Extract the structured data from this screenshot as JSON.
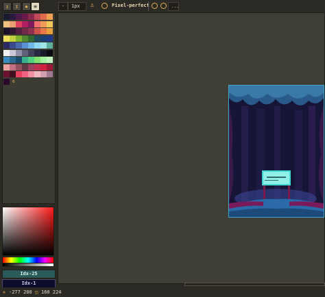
{
  "toolbar": {
    "brush_size": "1px",
    "pixel_perfect_label": "Pixel-perfect",
    "more_label": "..."
  },
  "palette": {
    "colors": [
      "#1a1a2e",
      "#2a1a3e",
      "#4a1a4a",
      "#6a1a4a",
      "#8a2a4a",
      "#c04a5a",
      "#e06a4a",
      "#f0a050",
      "#f0c080",
      "#e8a070",
      "#e04060",
      "#b02060",
      "#801a5a",
      "#f07070",
      "#f09a5a",
      "#f0c85a",
      "#1a1028",
      "#301830",
      "#502040",
      "#702a48",
      "#903050",
      "#d0504a",
      "#e87848",
      "#e8a040",
      "#f0e060",
      "#c0d040",
      "#80b030",
      "#508830",
      "#306830",
      "#20485a",
      "#184070",
      "#203888",
      "#2a2a60",
      "#3a4a90",
      "#4a6ab0",
      "#5a90d0",
      "#70b8e8",
      "#90d8f0",
      "#a0e8e8",
      "#60b0a0",
      "#f0f0f0",
      "#c8c8d8",
      "#9090a8",
      "#606078",
      "#404058",
      "#282840",
      "#181828",
      "#0a0a14",
      "#3a8ac0",
      "#2a6a90",
      "#1a4a6a",
      "#3ab090",
      "#50d080",
      "#80e070",
      "#a0f0a0",
      "#c0f0c0",
      "#e8a0a0",
      "#c07080",
      "#905060",
      "#603848",
      "#a04060",
      "#c03050",
      "#d02040",
      "#a01838",
      "#6a1030",
      "#401020",
      "#e84060",
      "#f06080",
      "#f090a0",
      "#f0b8c0",
      "#d0a0b0",
      "#a07890",
      "#2a0a2a"
    ],
    "selected_index_label": "0"
  },
  "picker": {
    "index_primary": "Idx-25",
    "index_secondary": "Idx-1"
  },
  "status": {
    "cursor": "-277 280",
    "size": "160 224"
  },
  "colors": {
    "accent": "#e8b050",
    "panel": "#3d3c33",
    "canvas": "#403f36",
    "selection_border": "#3fa8c8"
  }
}
